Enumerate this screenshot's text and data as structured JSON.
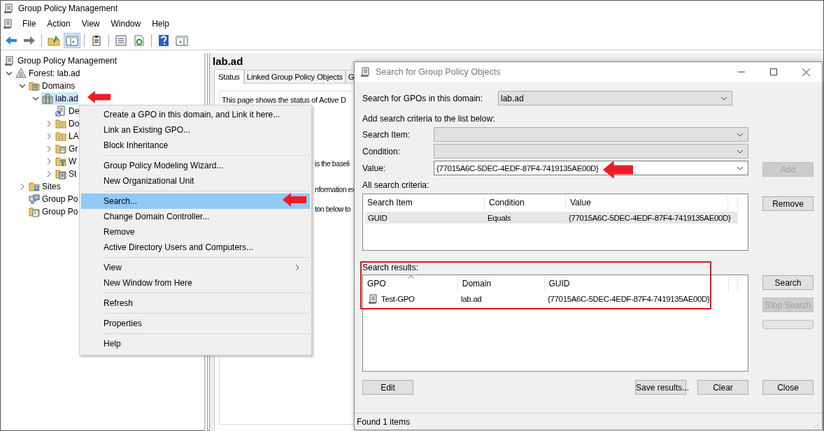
{
  "window": {
    "title": "Group Policy Management"
  },
  "menubar": [
    "File",
    "Action",
    "View",
    "Window",
    "Help"
  ],
  "toolbar": [
    {
      "kind": "back",
      "pressed": false
    },
    {
      "kind": "forward",
      "pressed": false
    },
    {
      "kind": "sep"
    },
    {
      "kind": "up",
      "pressed": false
    },
    {
      "kind": "tree",
      "pressed": true
    },
    {
      "kind": "sep"
    },
    {
      "kind": "clipboard",
      "pressed": false
    },
    {
      "kind": "sep"
    },
    {
      "kind": "properties",
      "pressed": false
    },
    {
      "kind": "refresh",
      "pressed": false
    },
    {
      "kind": "sep"
    },
    {
      "kind": "help",
      "pressed": false
    },
    {
      "kind": "pane",
      "pressed": false
    }
  ],
  "tree": {
    "items": [
      {
        "label": "Group Policy Management",
        "kind": "console",
        "selected": false,
        "children": [
          {
            "label": "Forest: lab.ad",
            "kind": "forest",
            "selected": false,
            "expanded": true,
            "children": [
              {
                "label": "Domains",
                "kind": "domains",
                "selected": false,
                "expanded": true,
                "children": [
                  {
                    "label": "lab.ad",
                    "kind": "domain",
                    "selected": true,
                    "expanded": true,
                    "children": [
                      {
                        "label": "De",
                        "kind": "gpo-link",
                        "selected": false
                      },
                      {
                        "label": "Do",
                        "kind": "ou",
                        "selected": false,
                        "expanded": false
                      },
                      {
                        "label": "LA",
                        "kind": "ou",
                        "selected": false,
                        "expanded": false
                      },
                      {
                        "label": "Gr",
                        "kind": "gpo-folder",
                        "selected": false,
                        "expanded": false
                      },
                      {
                        "label": "W",
                        "kind": "wmi",
                        "selected": false,
                        "expanded": false
                      },
                      {
                        "label": "St",
                        "kind": "starter",
                        "selected": false,
                        "expanded": false
                      }
                    ]
                  }
                ]
              },
              {
                "label": "Sites",
                "kind": "sites",
                "selected": false,
                "expanded": false
              },
              {
                "label": "Group Po",
                "kind": "modeling",
                "selected": false
              },
              {
                "label": "Group Po",
                "kind": "results",
                "selected": false
              }
            ]
          }
        ]
      }
    ]
  },
  "details": {
    "heading": "lab.ad",
    "tabs": [
      {
        "label": "Status",
        "selected": true
      },
      {
        "label": "Linked Group Policy Objects",
        "selected": false
      },
      {
        "label": "G",
        "selected": false
      }
    ],
    "lines": [
      "This page shows the status of Active D",
      "is the baseli",
      "nformation ex",
      "ton below to"
    ]
  },
  "context_menu": {
    "groups": [
      {
        "items": [
          {
            "label": "Create a GPO in this domain, and Link it here...",
            "selected": false
          },
          {
            "label": "Link an Existing GPO...",
            "selected": false
          },
          {
            "label": "Block Inheritance",
            "selected": false
          }
        ]
      },
      {
        "items": [
          {
            "label": "Group Policy Modeling Wizard...",
            "selected": false
          },
          {
            "label": "New Organizational Unit",
            "selected": false
          }
        ]
      },
      {
        "items": [
          {
            "label": "Search...",
            "selected": true
          },
          {
            "label": "Change Domain Controller...",
            "selected": false
          },
          {
            "label": "Remove",
            "selected": false
          },
          {
            "label": "Active Directory Users and Computers...",
            "selected": false
          }
        ]
      },
      {
        "items": [
          {
            "label": "View",
            "selected": false,
            "submenu": true
          },
          {
            "label": "New Window from Here",
            "selected": false
          }
        ]
      },
      {
        "items": [
          {
            "label": "Refresh",
            "selected": false
          }
        ]
      },
      {
        "items": [
          {
            "label": "Properties",
            "selected": false
          }
        ]
      },
      {
        "items": [
          {
            "label": "Help",
            "selected": false
          }
        ]
      }
    ]
  },
  "dialog": {
    "title": "Search for Group Policy Objects",
    "domain_label": "Search for GPOs in this domain:",
    "domain_combo": {
      "value": "lab.ad",
      "kind": "dropdown"
    },
    "criteria_heading": "Add search criteria to the list below:",
    "fields": [
      {
        "label": "Search Item:",
        "kind": "dropdown"
      },
      {
        "label": "Condition:",
        "kind": "dropdown"
      },
      {
        "label": "Value:",
        "kind": "editable",
        "value": "{77015A6C-5DEC-4EDF-87F4-7419135AE00D}"
      }
    ],
    "add_button": {
      "label": "Add",
      "disabled": true
    },
    "criteria": {
      "label": "All search criteria:",
      "columns": [
        "Search Item",
        "Condition",
        "Value"
      ],
      "rows": [
        {
          "cells": [
            "GUID",
            "Equals",
            "{77015A6C-5DEC-4EDF-87F4-7419135AE00D}"
          ],
          "selected": true
        }
      ]
    },
    "remove_button": {
      "label": "Remove",
      "disabled": false
    },
    "results": {
      "label": "Search results:",
      "columns": [
        {
          "label": "GPO",
          "sorted": true
        },
        {
          "label": "Domain",
          "sorted": false
        },
        {
          "label": "GUID",
          "sorted": false
        }
      ],
      "rows": [
        {
          "cells": [
            "Test-GPO",
            "lab.ad",
            "{77015A6C-5DEC-4EDF-87F4-7419135AE00D}"
          ],
          "selected": false
        }
      ]
    },
    "side_buttons": [
      {
        "label": "Search",
        "disabled": false
      },
      {
        "label": "Stop Search",
        "disabled": true
      }
    ],
    "progress": {
      "level": 0
    },
    "bottom_buttons": [
      {
        "label": "Edit",
        "disabled": false
      },
      {
        "label": "Save results...",
        "disabled": false
      },
      {
        "label": "Clear",
        "disabled": false
      },
      {
        "label": "Close",
        "disabled": false
      }
    ],
    "status": "Found 1 items"
  }
}
